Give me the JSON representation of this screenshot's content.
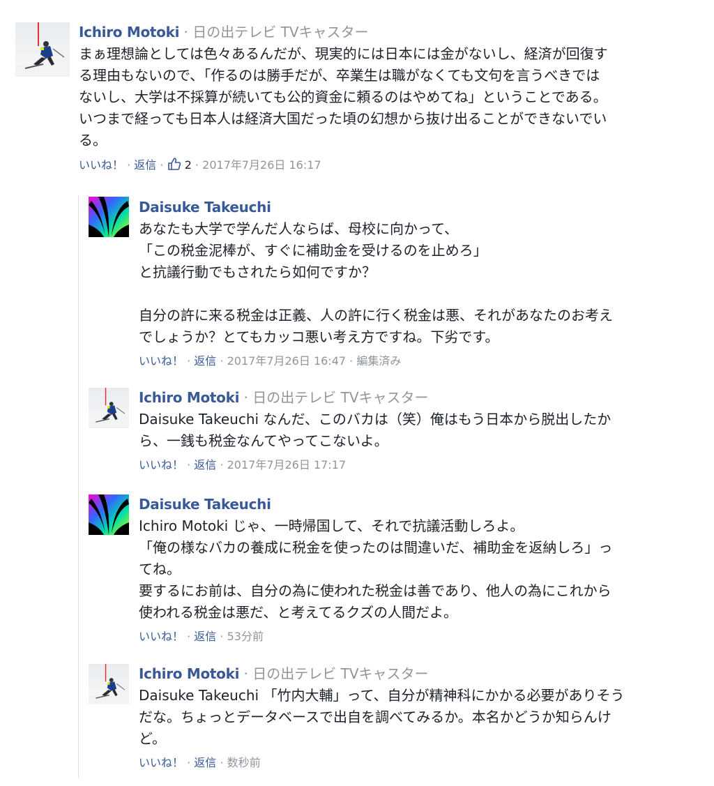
{
  "comments": [
    {
      "author": "Ichiro Motoki",
      "subtitle": "日の出テレビ TVキャスター",
      "text": "まぁ理想論としては色々あるんだが、現実的には日本には金がないし、経済が回復す\nる理由もないので、「作るのは勝手だが、卒業生は職がなくても文句を言うべきでは\nないし、大学は不採算が続いても公的資金に頼るのはやめてね」ということである。\nいつまで経っても日本人は経済大国だった頃の幻想から抜け出ることができないでい\nる。",
      "like_label": "いいね！",
      "reply_label": "返信",
      "like_count": "2",
      "timestamp": "2017年7月26日 16:17"
    },
    {
      "author": "Daisuke Takeuchi",
      "text": "あなたも大学で学んだ人ならば、母校に向かって、\n「この税金泥棒が、すぐに補助金を受けるのを止めろ」\nと抗議行動でもされたら如何ですか？\n\n自分の許に来る税金は正義、人の許に行く税金は悪、それがあなたのお考え\nでしょうか？とてもカッコ悪い考え方ですね。下劣です。",
      "like_label": "いいね！",
      "reply_label": "返信",
      "timestamp": "2017年7月26日 16:47",
      "edited": "編集済み"
    },
    {
      "author": "Ichiro Motoki",
      "subtitle": "日の出テレビ TVキャスター",
      "mention": "Daisuke Takeuchi",
      "text": " なんだ、このバカは（笑）俺はもう日本から脱出したか\nら、一銭も税金なんてやってこないよ。",
      "like_label": "いいね！",
      "reply_label": "返信",
      "timestamp": "2017年7月26日 17:17"
    },
    {
      "author": "Daisuke Takeuchi",
      "mention": "Ichiro Motoki",
      "text": " じゃ、一時帰国して、それで抗議活動しろよ。\n「俺の様なバカの養成に税金を使ったのは間違いだ、補助金を返納しろ」っ\nてね。\n要するにお前は、自分の為に使われた税金は善であり、他人の為にこれから\n使われる税金は悪だ、と考えてるクズの人間だよ。",
      "like_label": "いいね！",
      "reply_label": "返信",
      "timestamp": "53分前"
    },
    {
      "author": "Ichiro Motoki",
      "subtitle": "日の出テレビ TVキャスター",
      "mention": "Daisuke Takeuchi",
      "text": " 「竹内大輔」って、自分が精神科にかかる必要がありそう\nだな。ちょっとデータベースで出自を調べてみるか。本名かどうか知らんけ\nど。",
      "like_label": "いいね！",
      "reply_label": "返信",
      "timestamp": "数秒前"
    }
  ],
  "ui": {
    "separator": "·",
    "like_icon": "thumbs-up-icon",
    "link_color": "#385898",
    "meta_color": "#90949c"
  }
}
